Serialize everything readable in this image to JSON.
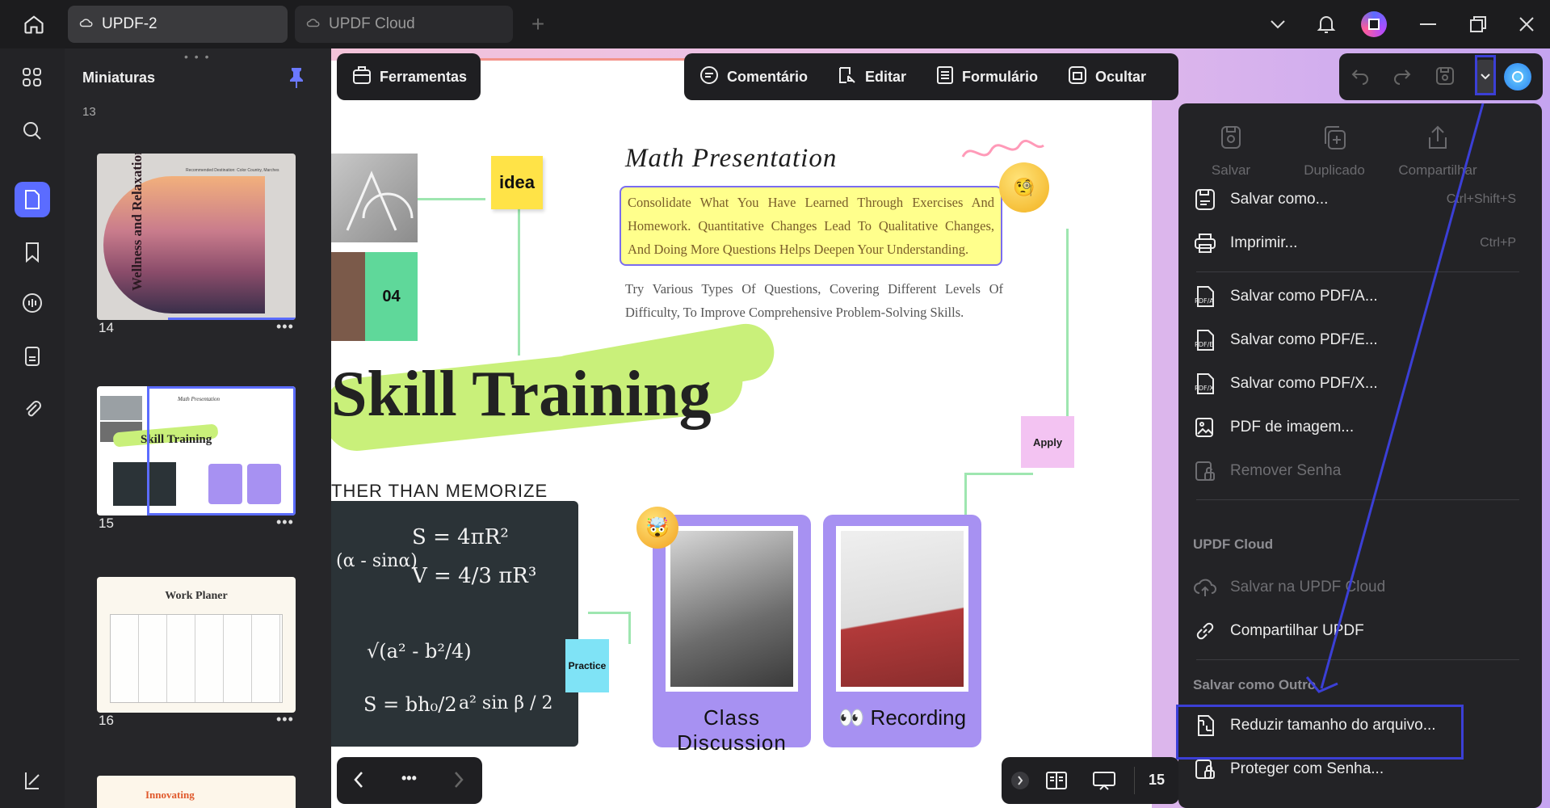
{
  "tabs": [
    {
      "label": "UPDF-2"
    },
    {
      "label": "UPDF Cloud"
    }
  ],
  "thumbnails": {
    "title": "Miniaturas",
    "pages": [
      {
        "number": "14"
      },
      {
        "number": "15"
      },
      {
        "number": "16"
      }
    ],
    "top_partial": "13",
    "thumb14": {
      "subtitle": "Recommended Destination: Color Country, Marches",
      "title": "Wellness and Relaxation"
    },
    "thumb15": {
      "title": "Skill Training",
      "subtitle": "Math Presentation"
    },
    "thumb16": {
      "title": "Work Planer"
    },
    "thumb17": {
      "title": "Innovating"
    }
  },
  "toolbar": {
    "tools": "Ferramentas",
    "comment": "Comentário",
    "edit": "Editar",
    "form": "Formulário",
    "hide": "Ocultar"
  },
  "slide": {
    "idea": "idea",
    "badge": "04",
    "math_title": "Math Presentation",
    "highlight": "Consolidate What You Have Learned Through Exercises And Homework. Quantitative Changes Lead To Qualitative Changes, And Doing More Questions Helps Deepen Your Understanding.",
    "body": "Try Various Types Of Questions, Covering Different Levels Of Difficulty, To Improve Comprehensive Problem-Solving Skills.",
    "headline": "Skill Training",
    "subhead": "THER THAN MEMORIZE",
    "apply": "Apply",
    "practice": "Practice",
    "card1": "Class Discussion",
    "card2": "Recording",
    "board_f1": "S = 4πR²",
    "board_f2": "V = 4/3 πR³",
    "board_f3": "(α - sinα)",
    "board_f4": "√(a² - b²/4)",
    "board_f5": "S = bh₀/2",
    "board_f6": "a² sin β / 2"
  },
  "menu": {
    "top": [
      {
        "label": "Salvar"
      },
      {
        "label": "Duplicado"
      },
      {
        "label": "Compartilhar"
      }
    ],
    "items": [
      {
        "label": "Salvar como...",
        "shortcut": "Ctrl+Shift+S"
      },
      {
        "label": "Imprimir...",
        "shortcut": "Ctrl+P"
      },
      {
        "label": "Salvar como PDF/A..."
      },
      {
        "label": "Salvar como PDF/E..."
      },
      {
        "label": "Salvar como PDF/X..."
      },
      {
        "label": "PDF de imagem..."
      },
      {
        "label": "Remover Senha"
      }
    ],
    "cloud_header": "UPDF Cloud",
    "cloud_items": [
      {
        "label": "Salvar na UPDF Cloud"
      },
      {
        "label": "Compartilhar UPDF"
      }
    ],
    "other_header": "Salvar como Outro",
    "other_items": [
      {
        "label": "Reduzir tamanho do arquivo..."
      },
      {
        "label": "Proteger com Senha..."
      }
    ]
  },
  "pagenav": {
    "current": "15"
  },
  "colors": {
    "accent": "#5b6cff",
    "highlight": "#3b3fd6",
    "lime": "#c9f07a"
  }
}
